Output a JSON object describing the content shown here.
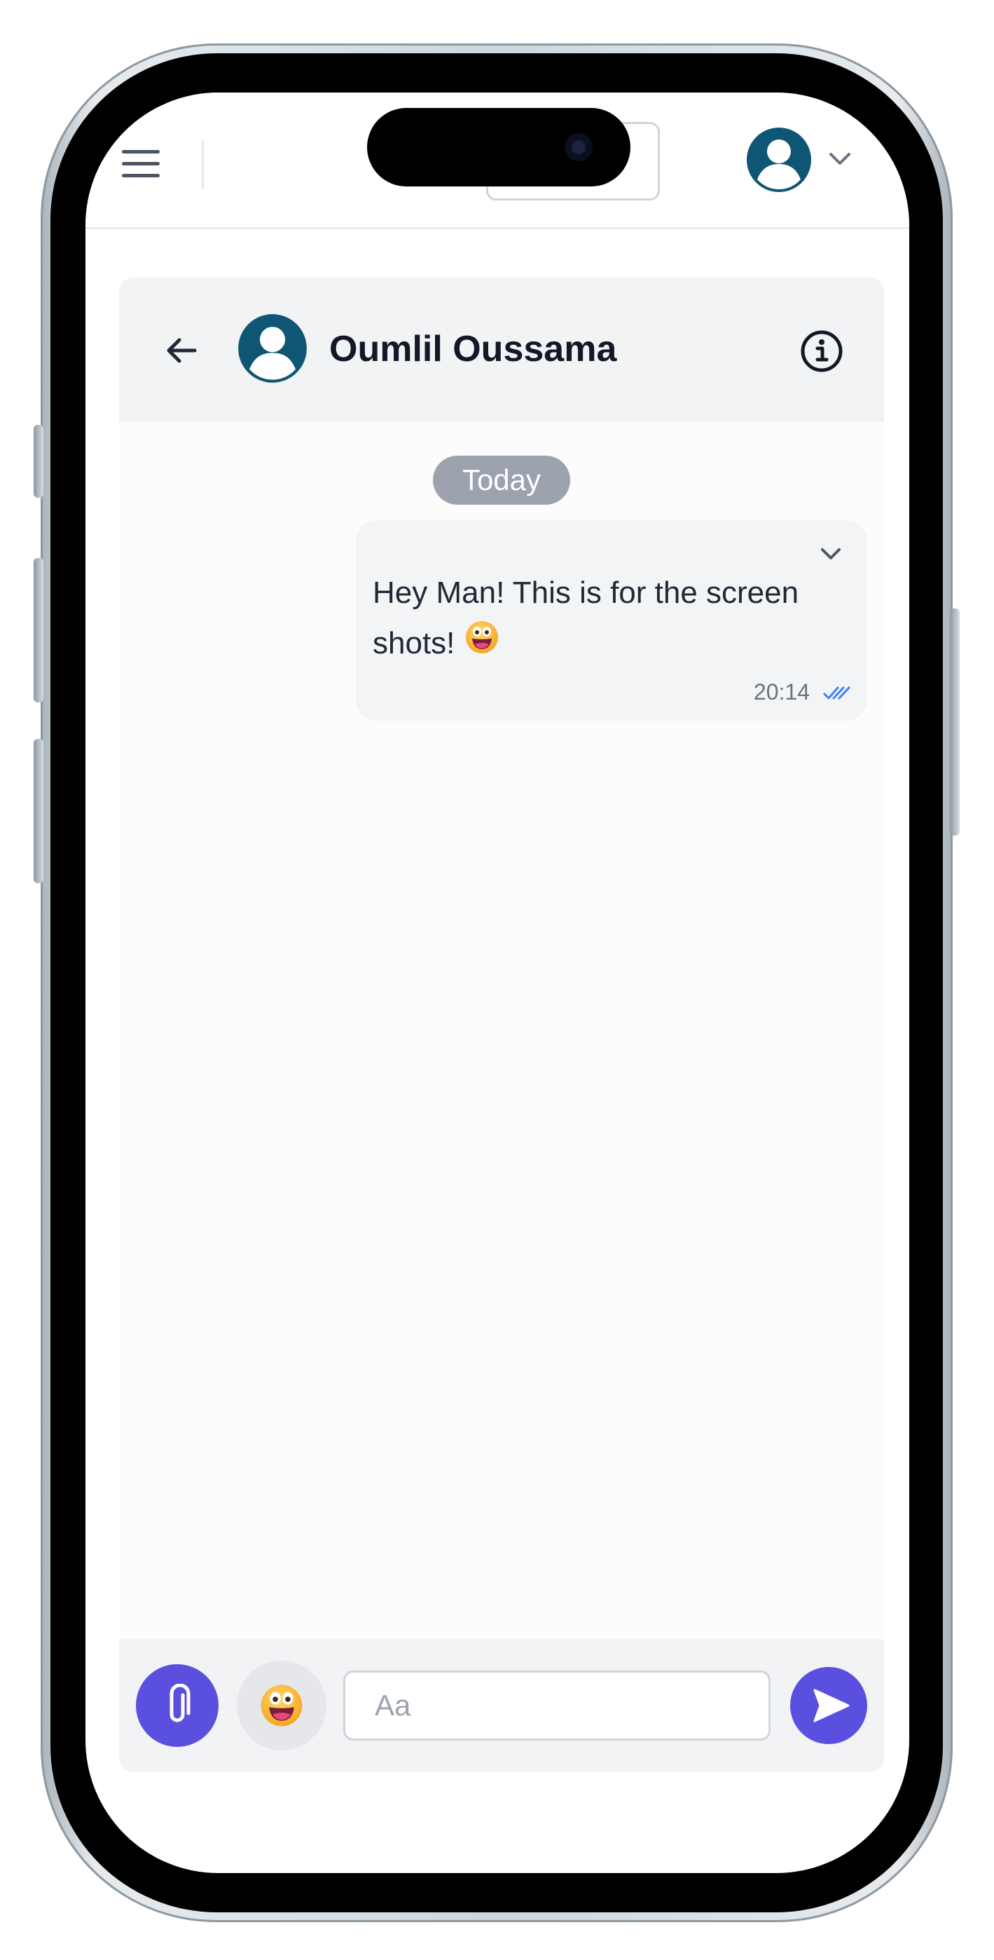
{
  "header": {
    "contact_name": "Oumlil Oussama"
  },
  "conversation": {
    "date_separator": "Today",
    "messages": [
      {
        "text": "Hey Man! This is for the screen shots!",
        "emoji": "grinning-face-emoji",
        "time": "20:14",
        "status": "read"
      }
    ]
  },
  "composer": {
    "placeholder": "Aa"
  },
  "colors": {
    "accent": "#5b4fe0",
    "avatar": "#0e5674",
    "read_check": "#3b82f6",
    "date_pill": "#9ca3af"
  },
  "icons": {
    "menu": "hamburger-icon",
    "profile": "user-avatar-icon",
    "dropdown": "chevron-down-icon",
    "back": "arrow-left-icon",
    "info": "info-icon",
    "attach": "paperclip-icon",
    "emoji": "smiley-emoji-icon",
    "send": "send-icon",
    "read_receipt": "double-check-icon"
  }
}
